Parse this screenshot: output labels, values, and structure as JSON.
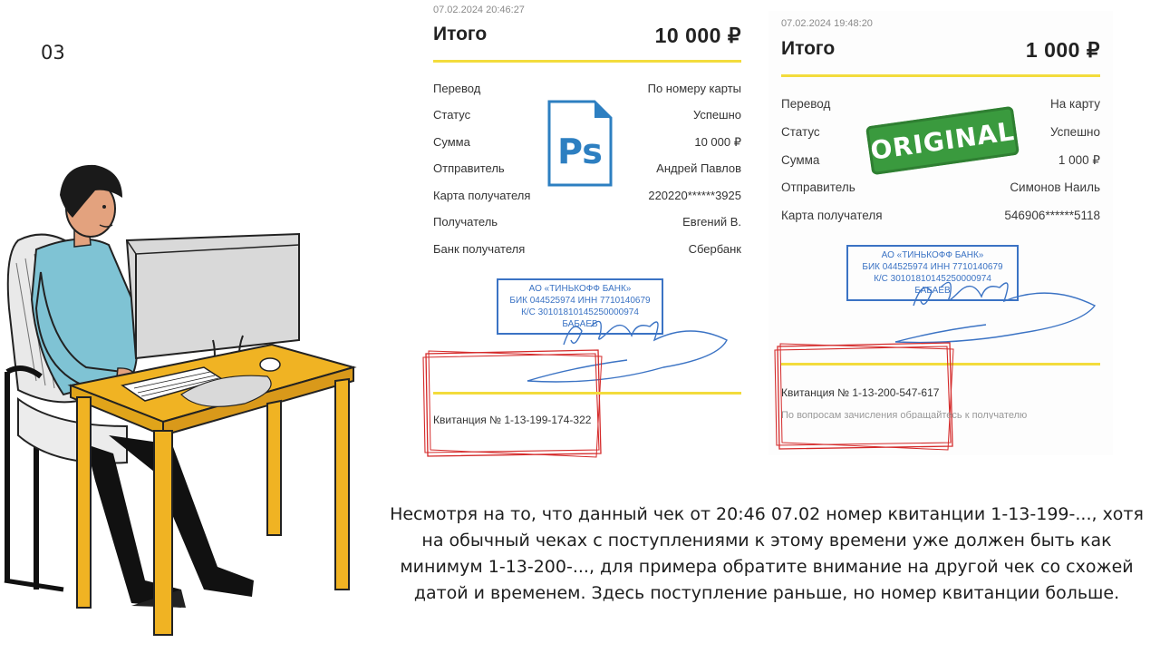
{
  "slide_number": "03",
  "receipt_left": {
    "datetime": "07.02.2024  20:46:27",
    "total_label": "Итого",
    "total_amount": "10 000 ₽",
    "rows": [
      {
        "label": "Перевод",
        "value": "По номеру карты"
      },
      {
        "label": "Статус",
        "value": "Успешно"
      },
      {
        "label": "Сумма",
        "value": "10 000 ₽"
      },
      {
        "label": "Отправитель",
        "value": "Андрей Павлов"
      },
      {
        "label": "Карта получателя",
        "value": "220220******3925"
      },
      {
        "label": "Получатель",
        "value": "Евгений В."
      },
      {
        "label": "Банк получателя",
        "value": "Сбербанк"
      }
    ],
    "stamp_lines": [
      "АО «ТИНЬКОФФ БАНК»",
      "БИК 044525974 ИНН 7710140679",
      "К/С 30101810145250000974",
      "БАБАЕВ"
    ],
    "receipt_number": "Квитанция  № 1-13-199-174-322"
  },
  "receipt_right": {
    "datetime": "07.02.2024  19:48:20",
    "total_label": "Итого",
    "total_amount": "1 000 ₽",
    "rows": [
      {
        "label": "Перевод",
        "value": "На карту"
      },
      {
        "label": "Статус",
        "value": "Успешно"
      },
      {
        "label": "Сумма",
        "value": "1 000 ₽"
      },
      {
        "label": "Отправитель",
        "value": "Симонов Наиль"
      },
      {
        "label": "Карта получателя",
        "value": "546906******5118"
      }
    ],
    "stamp_lines": [
      "АО «ТИНЬКОФФ БАНК»",
      "БИК 044525974 ИНН 7710140679",
      "К/С 30101810145250000974",
      "БАБАЕВ"
    ],
    "receipt_number": "Квитанция  № 1-13-200-547-617",
    "footer_faded": "По вопросам зачисления обращайтесь к получателю"
  },
  "ps_icon_text": "Ps",
  "original_stamp_text": "ORIGINAL",
  "caption": "Несмотря на то, что данный чек от 20:46 07.02 номер квитанции 1-13-199-..., хотя на обычный чеках с поступлениями к этому времени уже должен быть как минимум 1-13-200-..., для примера обратите внимание на другой чек со схожей датой и временем. Здесь поступление раньше, но номер квитанции больше.",
  "colors": {
    "accent_yellow": "#f3dc3c",
    "stamp_blue": "#3b73c4",
    "highlight_red": "#d42a2a",
    "original_green": "#3a9a3e",
    "ps_blue": "#2d7fc1",
    "desk_yellow": "#f0b323",
    "shirt_blue": "#7fc3d4"
  }
}
